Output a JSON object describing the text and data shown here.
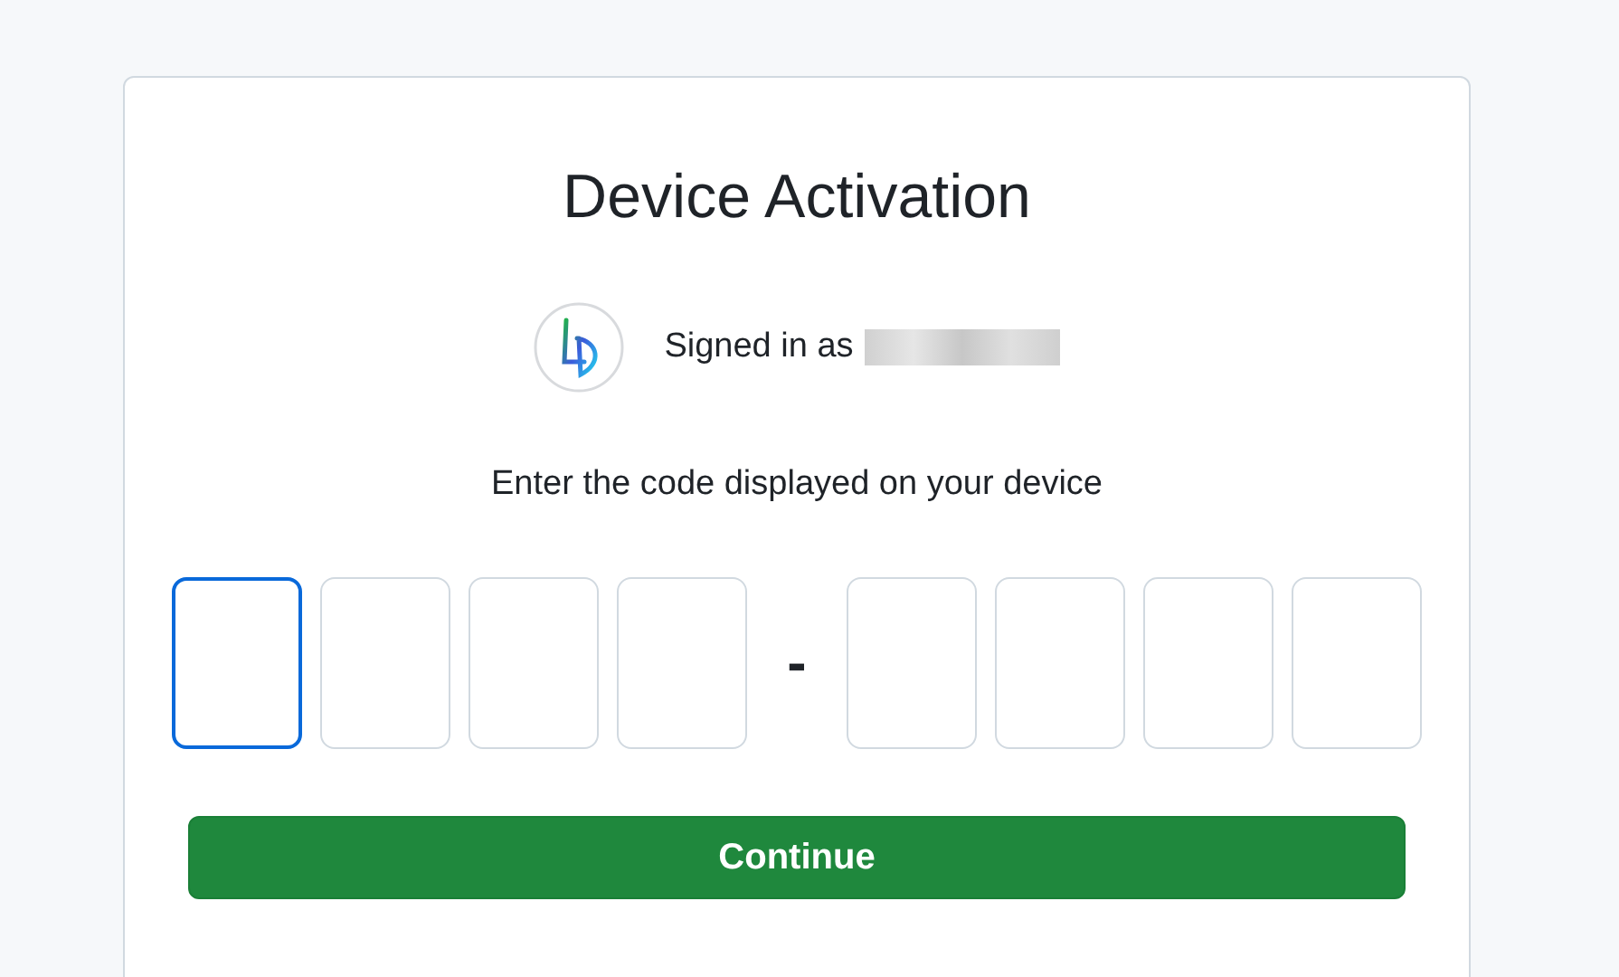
{
  "title": "Device Activation",
  "account": {
    "label": "Signed in as",
    "name_redacted": true
  },
  "prompt": "Enter the code displayed on your device",
  "code": [
    {
      "kind": "cell",
      "focused": true
    },
    {
      "kind": "cell",
      "focused": false
    },
    {
      "kind": "cell",
      "focused": false
    },
    {
      "kind": "cell",
      "focused": false
    },
    {
      "kind": "separator",
      "text": "-"
    },
    {
      "kind": "cell",
      "focused": false
    },
    {
      "kind": "cell",
      "focused": false
    },
    {
      "kind": "cell",
      "focused": false
    },
    {
      "kind": "cell",
      "focused": false
    }
  ],
  "button": "Continue"
}
